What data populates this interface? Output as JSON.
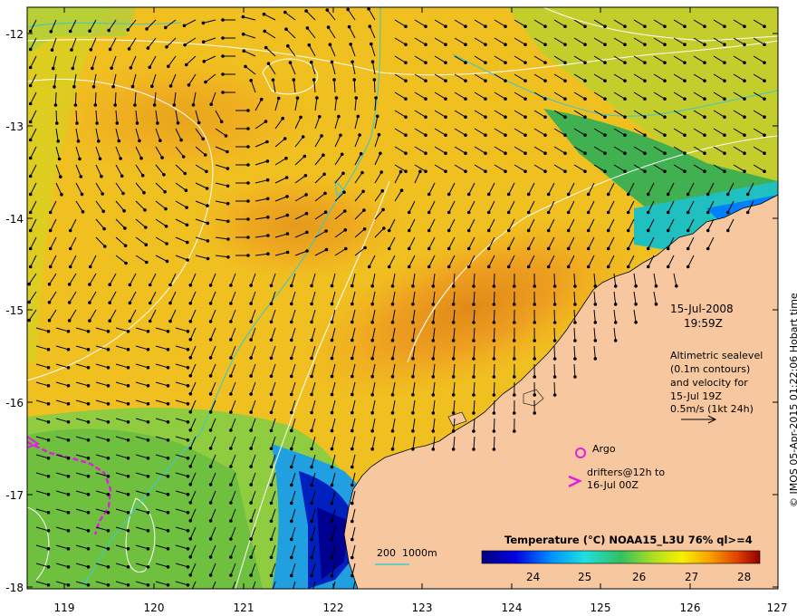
{
  "map": {
    "date": "15-Jul-2008",
    "time": "19:59Z",
    "info_lines": [
      "Altimetric sealevel",
      "(0.1m contours)",
      "and velocity for",
      "15-Jul 19Z",
      "0.5m/s (1kt 24h)"
    ],
    "legend_argo": "Argo",
    "legend_drifters_1": "drifters@12h to",
    "legend_drifters_2": "16-Jul 00Z",
    "depth_label": "200  1000m",
    "credit": "© IMOS 05-Apr-2015 01:22:06 Hobart time",
    "colorbar_title": "Temperature (°C) NOAA15_L3U 76% ql>=4",
    "colorbar_ticks": [
      "24",
      "25",
      "26",
      "27",
      "28"
    ],
    "lat_ticks": [
      "-12",
      "-13",
      "-14",
      "-15",
      "-16",
      "-17",
      "-18"
    ],
    "lon_ticks": [
      "119",
      "120",
      "121",
      "122",
      "123",
      "124",
      "125",
      "126",
      "127"
    ],
    "colors": {
      "land": "#f7c8a0",
      "argo": "#e020e0",
      "isobath": "#40c8c8",
      "contour": "#ffffff"
    }
  }
}
